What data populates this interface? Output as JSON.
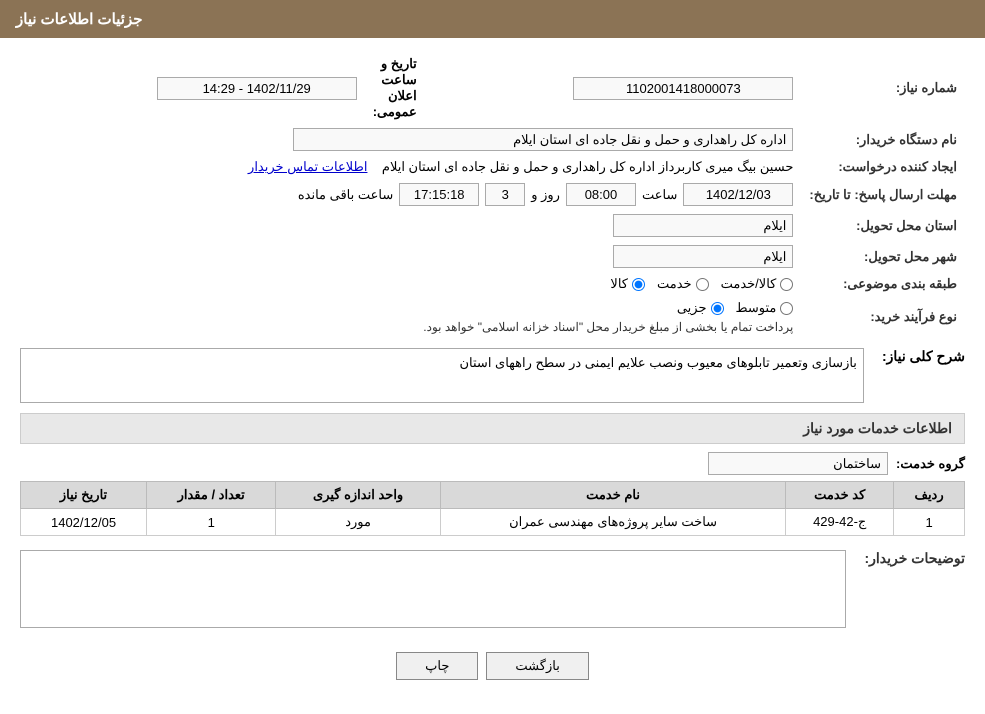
{
  "header": {
    "title": "جزئیات اطلاعات نیاز"
  },
  "labels": {
    "need_number": "شماره نیاز:",
    "buyer_org": "نام دستگاه خریدار:",
    "creator": "ایجاد کننده درخواست:",
    "deadline": "مهلت ارسال پاسخ: تا تاریخ:",
    "province": "استان محل تحویل:",
    "city": "شهر محل تحویل:",
    "category": "طبقه بندی موضوعی:",
    "purchase_type": "نوع فرآیند خرید:",
    "need_desc": "شرح کلی نیاز:",
    "services_info": "اطلاعات خدمات مورد نیاز",
    "service_group": "گروه خدمت:",
    "buyer_notes": "توضیحات خریدار:"
  },
  "values": {
    "need_number": "1102001418000073",
    "public_announce_label": "تاریخ و ساعت اعلان عمومی:",
    "public_announce_date": "1402/11/29 - 14:29",
    "buyer_org": "اداره کل راهداری و حمل و نقل جاده ای استان ایلام",
    "creator_name": "حسین بیگ میری کاربرداز اداره کل راهداری و حمل و نقل جاده ای استان ایلام",
    "contact_link": "اطلاعات تماس خریدار",
    "deadline_date": "1402/12/03",
    "deadline_time_label": "ساعت",
    "deadline_time": "08:00",
    "deadline_days_label": "روز و",
    "deadline_days": "3",
    "deadline_remaining_label": "ساعت باقی مانده",
    "deadline_remaining": "17:15:18",
    "province_value": "ایلام",
    "city_value": "ایلام",
    "category_options": [
      "کالا",
      "خدمت",
      "کالا/خدمت"
    ],
    "category_selected": "کالا",
    "purchase_type_options": [
      "جزیی",
      "متوسط"
    ],
    "purchase_type_selected": "جزیی",
    "purchase_type_note": "پرداخت تمام یا بخشی از مبلغ خریدار محل \"اسناد خزانه اسلامی\" خواهد بود.",
    "need_desc_value": "بازسازی وتعمیر تابلوهای معیوب ونصب علایم ایمنی در سطح راههای استان",
    "service_group_value": "ساختمان",
    "table": {
      "columns": [
        "ردیف",
        "کد خدمت",
        "نام خدمت",
        "واحد اندازه گیری",
        "تعداد / مقدار",
        "تاریخ نیاز"
      ],
      "rows": [
        {
          "row": "1",
          "code": "ج-42-429",
          "name": "ساخت سایر پروژه‌های مهندسی عمران",
          "unit": "مورد",
          "qty": "1",
          "date": "1402/12/05"
        }
      ]
    },
    "buyer_notes_value": "",
    "btn_print": "چاپ",
    "btn_back": "بازگشت"
  }
}
